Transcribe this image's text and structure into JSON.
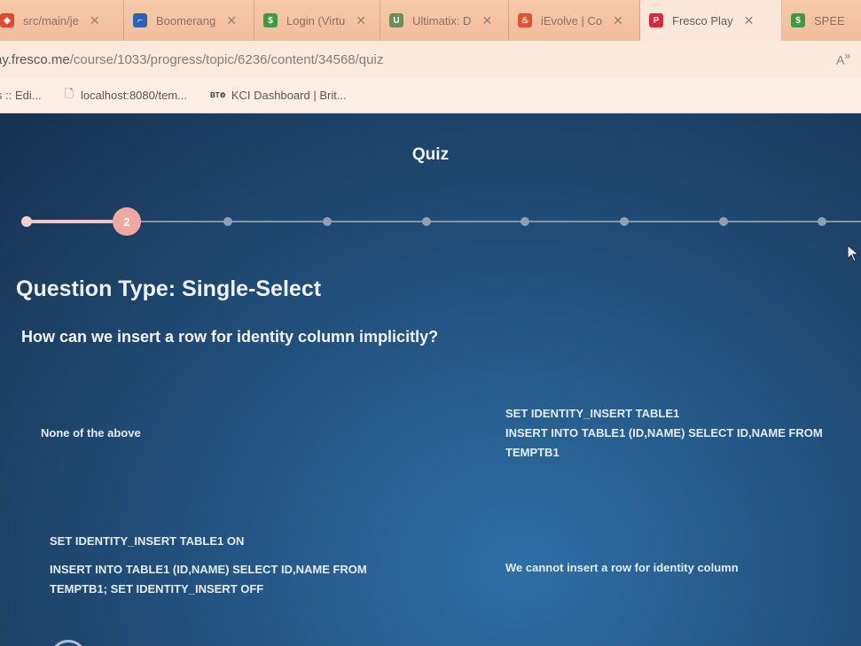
{
  "browser": {
    "tabs": [
      {
        "label": "src/main/je",
        "icon": "gitlab-icon",
        "color": "#e2492f",
        "active": false
      },
      {
        "label": "Boomerang",
        "icon": "hockey-stick-icon",
        "color": "#2b62b5",
        "active": false
      },
      {
        "label": "Login (Virtu",
        "icon": "dollar-icon",
        "color": "#3f9b3f",
        "active": false
      },
      {
        "label": "Ultimatix: D",
        "icon": "ultimatix-icon",
        "color": "#6b8e5a",
        "active": false
      },
      {
        "label": "iEvolve | Co",
        "icon": "flame-icon",
        "color": "#e05530",
        "active": false
      },
      {
        "label": "Fresco Play",
        "icon": "fresco-icon",
        "color": "#d8283a",
        "active": true
      },
      {
        "label": "SPEE",
        "icon": "dollar-icon",
        "color": "#3f9b3f",
        "active": false
      }
    ],
    "url": {
      "host": "ay.fresco.me",
      "path": "/course/1033/progress/topic/6236/content/34568/quiz"
    },
    "bookmarks": [
      {
        "label": "s :: Edi...",
        "icon": ""
      },
      {
        "label": "localhost:8080/tem...",
        "icon": "page-icon"
      },
      {
        "label": "KCI Dashboard | Brit...",
        "icon": "bt-logo-icon"
      }
    ]
  },
  "quiz": {
    "title": "Quiz",
    "current_step": "2",
    "question_type": "Question Type: Single-Select",
    "question": "How can we insert a row for identity column implicitly?",
    "options": {
      "a": [
        "None of the above"
      ],
      "b": [
        "SET IDENTITY_INSERT TABLE1",
        "INSERT INTO TABLE1 (ID,NAME) SELECT ID,NAME FROM",
        "TEMPTB1"
      ],
      "c": [
        "SET IDENTITY_INSERT TABLE1 ON",
        "INSERT INTO TABLE1 (ID,NAME) SELECT ID,NAME FROM",
        "TEMPTB1; SET IDENTITY_INSERT OFF"
      ],
      "d": [
        "We cannot insert a row for identity column"
      ]
    }
  },
  "colors": {
    "tabbar": "#f2bd9c",
    "page_bg": "#22517e",
    "progress_done": "#f2c6c2",
    "current_step": "#f0a8a0"
  }
}
